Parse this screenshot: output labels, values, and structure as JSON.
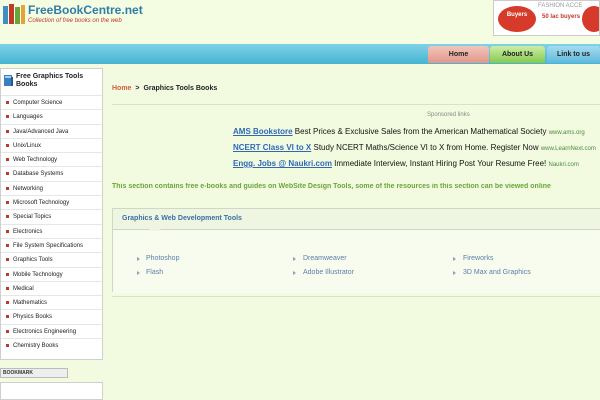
{
  "header": {
    "site_name": "FreeBookCentre.net",
    "tagline": "Collection of free books on the web",
    "ad": {
      "left_badge": "Buyers",
      "brand": "FASHION ACCE",
      "middle_text": "50 lac buyers",
      "accent_color": "#d63a2a"
    }
  },
  "nav": {
    "home": "Home",
    "about": "About Us",
    "link": "Link to us"
  },
  "sidebar": {
    "title": "Free Graphics Tools Books",
    "items": [
      "Computer Science",
      "Languages",
      "Java/Advanced Java",
      "Unix/Linux",
      "Web Technology",
      "Database Systems",
      "Networking",
      "Microsoft Technology",
      "Special Topics",
      "Electronics",
      "File System Specifications",
      "Graphics Tools",
      "Mobile Technology",
      "Medical",
      "Mathematics",
      "Physics Books",
      "Electronics Engineering",
      "Chemistry Books"
    ],
    "bookmark_label": "BOOKMARK"
  },
  "breadcrumb": {
    "home": "Home",
    "separator": ">",
    "current": "Graphics Tools Books"
  },
  "sponsored": {
    "label": "Sponsored links",
    "ads": [
      {
        "title": "AMS Bookstore",
        "text": "Best Prices & Exclusive Sales from the American Mathematical Society",
        "url": "www.ams.org"
      },
      {
        "title": "NCERT Class VI to X",
        "text": "Study NCERT Maths/Science VI to X from Home. Register Now",
        "url": "www.LearnNext.com"
      },
      {
        "title": "Engg. Jobs @ Naukri.com",
        "text": "Immediate Interview, Instant Hiring Post Your Resume Free!",
        "url": "Naukri.com"
      }
    ]
  },
  "intro": "This section contains free e-books and guides on WebSite Design Tools, some of the resources in this section can be viewed online",
  "panel": {
    "title": "Graphics & Web Development Tools",
    "items": [
      "Photoshop",
      "Dreamweaver",
      "Fireworks",
      "Flash",
      "Adobe Illustrator",
      "3D Max and Graphics"
    ]
  },
  "colors": {
    "page_bg": "#f2fbe0",
    "nav_blue": "#45b4d2",
    "link_blue": "#2e68b6",
    "intro_green": "#6aa53b",
    "accent_red": "#c0392b"
  }
}
